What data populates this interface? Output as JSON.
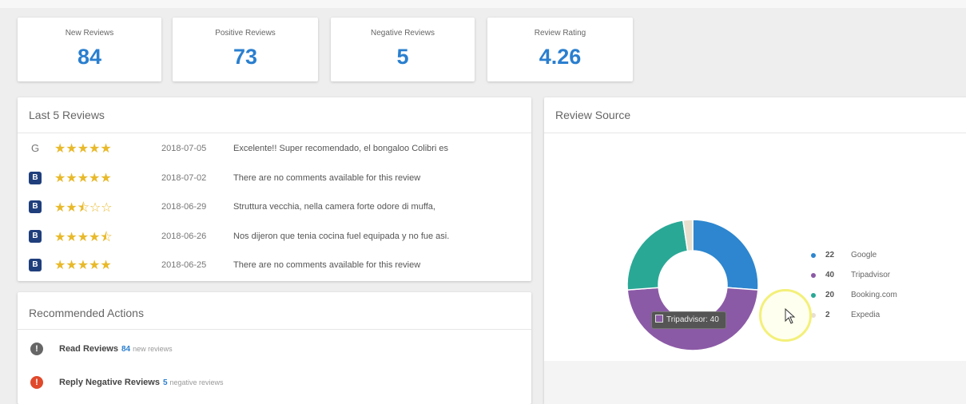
{
  "stats": [
    {
      "label": "New Reviews",
      "value": "84"
    },
    {
      "label": "Positive Reviews",
      "value": "73"
    },
    {
      "label": "Negative Reviews",
      "value": "5"
    },
    {
      "label": "Review Rating",
      "value": "4.26"
    }
  ],
  "last_reviews": {
    "title": "Last 5 Reviews",
    "items": [
      {
        "source": "G",
        "source_name": "Google",
        "rating": 5,
        "stars": "★★★★★",
        "date": "2018-07-05",
        "text": "Excelente!! Super recomendado, el bongaloo Colibri es"
      },
      {
        "source": "B",
        "source_name": "Booking.com",
        "rating": 5,
        "stars": "★★★★★",
        "date": "2018-07-02",
        "text": "There are no comments available for this review"
      },
      {
        "source": "B",
        "source_name": "Booking.com",
        "rating": 2.5,
        "stars": "★★⯪☆☆",
        "date": "2018-06-29",
        "text": "Struttura vecchia, nella camera forte odore di muffa,"
      },
      {
        "source": "B",
        "source_name": "Booking.com",
        "rating": 4.5,
        "stars": "★★★★⯪",
        "date": "2018-06-26",
        "text": "Nos dijeron que tenia cocina fuel equipada y no fue asi."
      },
      {
        "source": "B",
        "source_name": "Booking.com",
        "rating": 5,
        "stars": "★★★★★",
        "date": "2018-06-25",
        "text": "There are no comments available for this review"
      }
    ]
  },
  "actions": {
    "title": "Recommended Actions",
    "items": [
      {
        "icon": "info-icon",
        "label": "Read Reviews",
        "count": "84",
        "suffix": "new reviews",
        "color": "#666666"
      },
      {
        "icon": "alert-icon",
        "label": "Reply Negative Reviews",
        "count": "5",
        "suffix": "negative reviews",
        "color": "#e0492b"
      }
    ]
  },
  "review_source": {
    "title": "Review Source",
    "legend": [
      {
        "count": "22",
        "name": "Google",
        "color": "#2d86cf"
      },
      {
        "count": "40",
        "name": "Tripadvisor",
        "color": "#8b5aa6"
      },
      {
        "count": "20",
        "name": "Booking.com",
        "color": "#2aa896"
      },
      {
        "count": "2",
        "name": "Expedia",
        "color": "#e8dfcf"
      }
    ],
    "tooltip": "Tripadvisor: 40"
  }
}
